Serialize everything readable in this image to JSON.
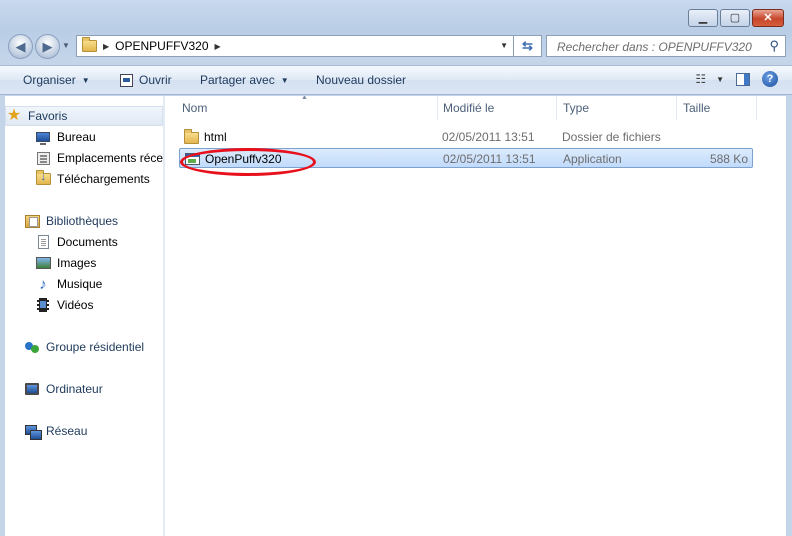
{
  "window": {
    "caption_buttons": [
      {
        "name": "minimize",
        "glyph": "▁"
      },
      {
        "name": "maximize",
        "glyph": "▢"
      },
      {
        "name": "close",
        "glyph": "✕"
      }
    ]
  },
  "address_bar": {
    "path": "OPENPUFFV320",
    "search_placeholder": "Rechercher dans : OPENPUFFV320"
  },
  "toolbar": {
    "organize": "Organiser",
    "open": "Ouvrir",
    "share": "Partager avec",
    "new_folder": "Nouveau dossier"
  },
  "nav_pane": {
    "favorites": {
      "label": "Favoris",
      "items": [
        {
          "label": "Bureau",
          "icon": "desktop-icon"
        },
        {
          "label": "Emplacements récen",
          "icon": "recent-places-icon"
        },
        {
          "label": "Téléchargements",
          "icon": "downloads-icon"
        }
      ]
    },
    "libraries": {
      "label": "Bibliothèques",
      "items": [
        {
          "label": "Documents",
          "icon": "documents-icon"
        },
        {
          "label": "Images",
          "icon": "images-icon"
        },
        {
          "label": "Musique",
          "icon": "music-icon"
        },
        {
          "label": "Vidéos",
          "icon": "videos-icon"
        }
      ]
    },
    "homegroup": "Groupe résidentiel",
    "computer": "Ordinateur",
    "network": "Réseau"
  },
  "file_list": {
    "columns": [
      "Nom",
      "Modifié le",
      "Type",
      "Taille"
    ],
    "rows": [
      {
        "name": "html",
        "modified": "02/05/2011 13:51",
        "type": "Dossier de fichiers",
        "size": "",
        "icon": "folder-icon",
        "selected": false
      },
      {
        "name": "OpenPuffv320",
        "modified": "02/05/2011 13:51",
        "type": "Application",
        "size": "588 Ko",
        "icon": "application-icon",
        "selected": true
      }
    ]
  },
  "colors": {
    "frame": "#c4d5ea",
    "selection": "#c1dbfc",
    "annotation": "#e8101c",
    "text_link": "#1e395b"
  }
}
